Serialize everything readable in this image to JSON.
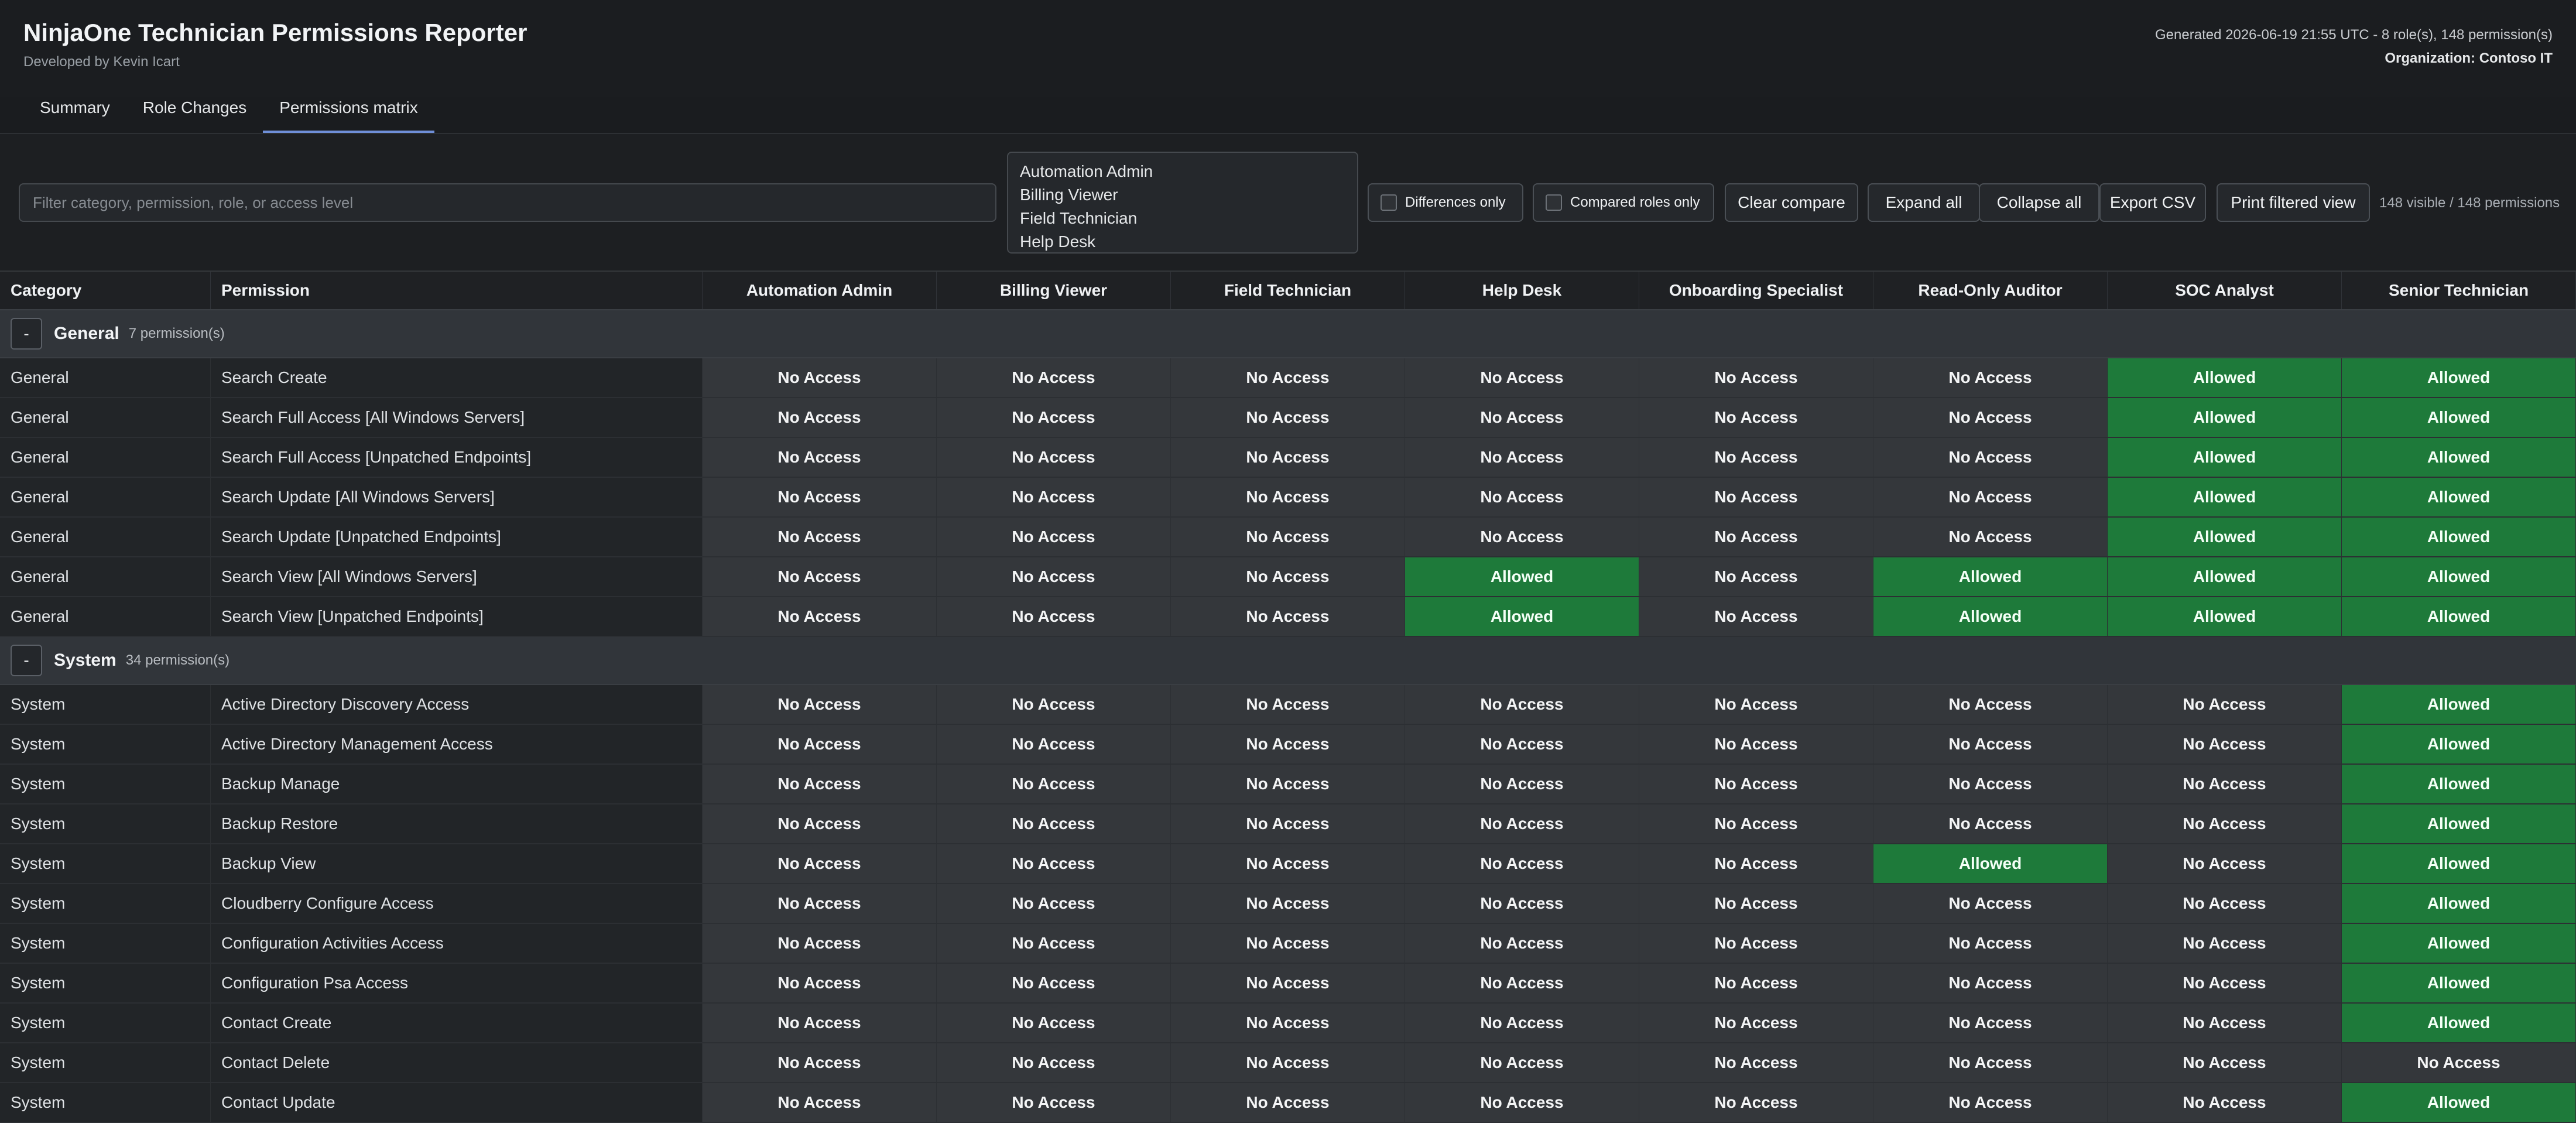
{
  "header": {
    "title": "NinjaOne Technician Permissions Reporter",
    "subtitle": "Developed by Kevin Icart",
    "generated": "Generated 2026-06-19 21:55 UTC - 8 role(s), 148 permission(s)",
    "organization": "Organization: Contoso IT"
  },
  "tabs": [
    {
      "label": "Summary"
    },
    {
      "label": "Role Changes"
    },
    {
      "label": "Permissions matrix"
    }
  ],
  "toolbar": {
    "filter_placeholder": "Filter category, permission, role, or access level",
    "role_options": [
      "Automation Admin",
      "Billing Viewer",
      "Field Technician",
      "Help Desk"
    ],
    "differences_only": "Differences only",
    "compared_roles_only": "Compared roles only",
    "clear_compare": "Clear compare",
    "expand_all": "Expand all",
    "collapse_all": "Collapse all",
    "export_csv": "Export CSV",
    "print_view": "Print filtered view",
    "visible_count": "148 visible / 148 permissions"
  },
  "table": {
    "col_category": "Category",
    "col_permission": "Permission",
    "roles": [
      "Automation Admin",
      "Billing Viewer",
      "Field Technician",
      "Help Desk",
      "Onboarding Specialist",
      "Read-Only Auditor",
      "SOC Analyst",
      "Senior Technician"
    ],
    "label_allowed": "Allowed",
    "label_no_access": "No Access",
    "groups": [
      {
        "toggle": "-",
        "name": "General",
        "count": "7 permission(s)",
        "rows": [
          {
            "category": "General",
            "permission": "Search Create",
            "access": [
              0,
              0,
              0,
              0,
              0,
              0,
              1,
              1
            ]
          },
          {
            "category": "General",
            "permission": "Search Full Access [All Windows Servers]",
            "access": [
              0,
              0,
              0,
              0,
              0,
              0,
              1,
              1
            ]
          },
          {
            "category": "General",
            "permission": "Search Full Access [Unpatched Endpoints]",
            "access": [
              0,
              0,
              0,
              0,
              0,
              0,
              1,
              1
            ]
          },
          {
            "category": "General",
            "permission": "Search Update [All Windows Servers]",
            "access": [
              0,
              0,
              0,
              0,
              0,
              0,
              1,
              1
            ]
          },
          {
            "category": "General",
            "permission": "Search Update [Unpatched Endpoints]",
            "access": [
              0,
              0,
              0,
              0,
              0,
              0,
              1,
              1
            ]
          },
          {
            "category": "General",
            "permission": "Search View [All Windows Servers]",
            "access": [
              0,
              0,
              0,
              1,
              0,
              1,
              1,
              1
            ]
          },
          {
            "category": "General",
            "permission": "Search View [Unpatched Endpoints]",
            "access": [
              0,
              0,
              0,
              1,
              0,
              1,
              1,
              1
            ]
          }
        ]
      },
      {
        "toggle": "-",
        "name": "System",
        "count": "34 permission(s)",
        "rows": [
          {
            "category": "System",
            "permission": "Active Directory Discovery Access",
            "access": [
              0,
              0,
              0,
              0,
              0,
              0,
              0,
              1
            ]
          },
          {
            "category": "System",
            "permission": "Active Directory Management Access",
            "access": [
              0,
              0,
              0,
              0,
              0,
              0,
              0,
              1
            ]
          },
          {
            "category": "System",
            "permission": "Backup Manage",
            "access": [
              0,
              0,
              0,
              0,
              0,
              0,
              0,
              1
            ]
          },
          {
            "category": "System",
            "permission": "Backup Restore",
            "access": [
              0,
              0,
              0,
              0,
              0,
              0,
              0,
              1
            ]
          },
          {
            "category": "System",
            "permission": "Backup View",
            "access": [
              0,
              0,
              0,
              0,
              0,
              1,
              0,
              1
            ]
          },
          {
            "category": "System",
            "permission": "Cloudberry Configure Access",
            "access": [
              0,
              0,
              0,
              0,
              0,
              0,
              0,
              1
            ]
          },
          {
            "category": "System",
            "permission": "Configuration Activities Access",
            "access": [
              0,
              0,
              0,
              0,
              0,
              0,
              0,
              1
            ]
          },
          {
            "category": "System",
            "permission": "Configuration Psa Access",
            "access": [
              0,
              0,
              0,
              0,
              0,
              0,
              0,
              1
            ]
          },
          {
            "category": "System",
            "permission": "Contact Create",
            "access": [
              0,
              0,
              0,
              0,
              0,
              0,
              0,
              1
            ]
          },
          {
            "category": "System",
            "permission": "Contact Delete",
            "access": [
              0,
              0,
              0,
              0,
              0,
              0,
              0,
              0
            ]
          },
          {
            "category": "System",
            "permission": "Contact Update",
            "access": [
              0,
              0,
              0,
              0,
              0,
              0,
              0,
              1
            ]
          }
        ]
      }
    ]
  }
}
